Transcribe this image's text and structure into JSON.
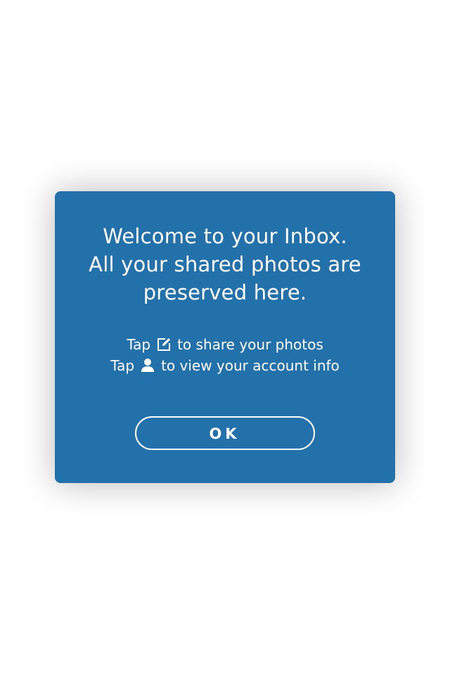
{
  "dialog": {
    "headline": {
      "line1": "Welcome to your Inbox.",
      "line2": "All your shared photos are",
      "line3": "preserved here."
    },
    "hints": [
      {
        "prefix": "Tap",
        "icon": "compose-edit-icon",
        "suffix": "to share your photos"
      },
      {
        "prefix": "Tap",
        "icon": "person-account-icon",
        "suffix": "to view your account info"
      }
    ],
    "ok_label": "OK"
  },
  "colors": {
    "background": "#ffffff",
    "dialog_bg": "#2271ab",
    "text": "#ffffff"
  }
}
